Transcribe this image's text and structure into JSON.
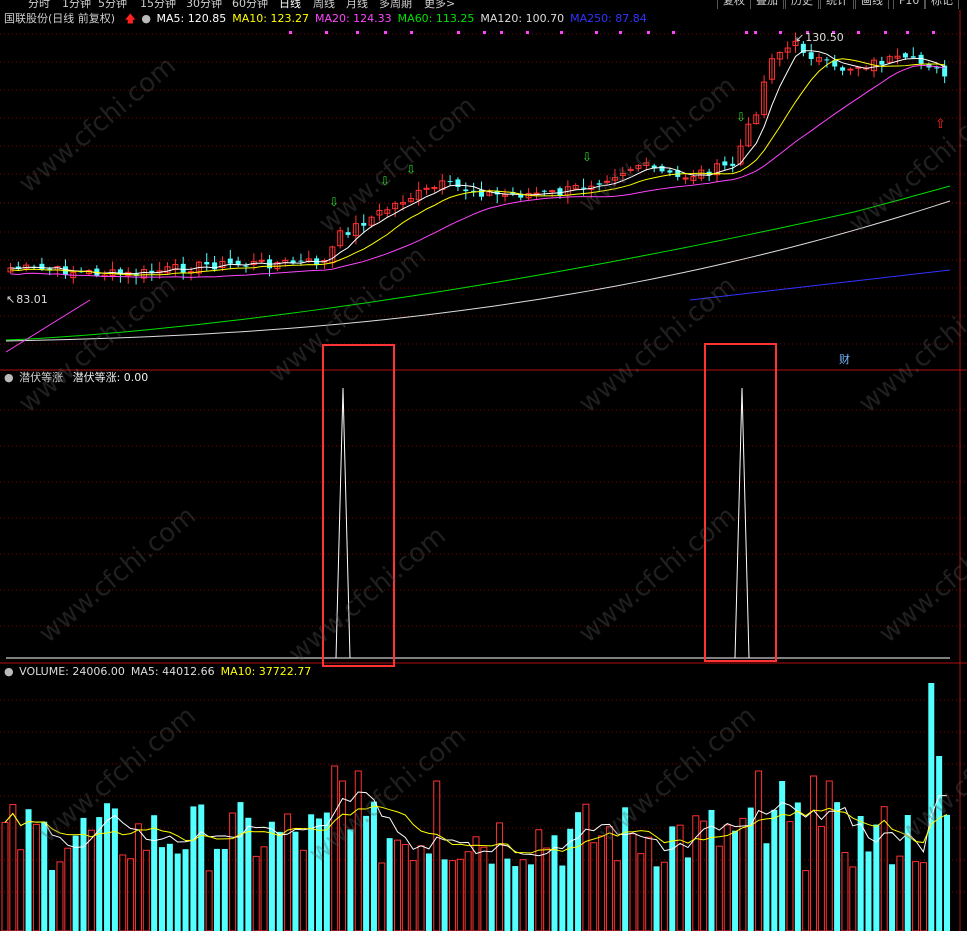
{
  "toolbar": {
    "periods": [
      "分时",
      "1分钟",
      "5分钟",
      "15分钟",
      "30分钟",
      "60分钟",
      "日线",
      "周线",
      "月线",
      "多周期",
      "更多>"
    ],
    "active_period": "日线",
    "buttons": [
      "复权",
      "叠加",
      "历史",
      "统计",
      "画线",
      "F10",
      "标记"
    ]
  },
  "price_panel": {
    "title": "国联股份(日线 前复权)",
    "ma": [
      {
        "label": "MA5: 120.85",
        "color": "#ffffff"
      },
      {
        "label": "MA10: 123.27",
        "color": "#ffff00"
      },
      {
        "label": "MA20: 124.33",
        "color": "#ff44ff"
      },
      {
        "label": "MA60: 113.25",
        "color": "#00e000"
      },
      {
        "label": "MA120: 100.70",
        "color": "#dddddd"
      },
      {
        "label": "MA250: 87.84",
        "color": "#3333ff"
      }
    ],
    "high_marker": "130.50",
    "low_marker": "83.01",
    "cai_marker": "财"
  },
  "indicator_panel": {
    "name": "潜伏等涨",
    "value_label": "潜伏等涨: 0.00"
  },
  "volume_panel": {
    "labels": [
      {
        "text": "VOLUME: 24006.00",
        "color": "#dddddd"
      },
      {
        "text": "MA5: 44012.66",
        "color": "#dddddd"
      },
      {
        "text": "MA10: 37722.77",
        "color": "#ffff00"
      }
    ]
  },
  "watermark": "www.cfchi.com",
  "colors": {
    "up": "#ff3232",
    "down": "#54ffff",
    "grid": "#8b0000",
    "highlight_box": "#ff3333"
  }
}
